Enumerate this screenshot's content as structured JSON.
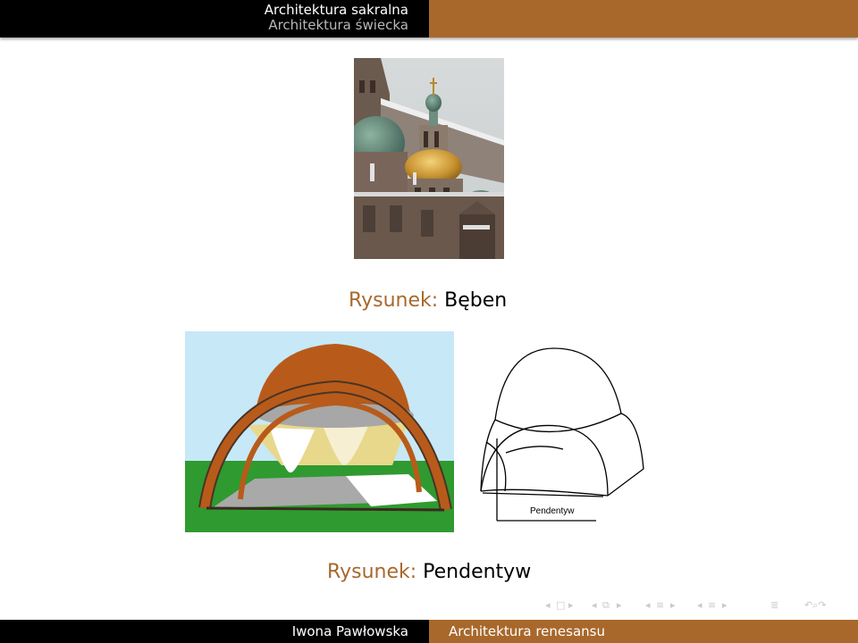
{
  "header": {
    "section_active": "Architektura sakralna",
    "section_inactive": "Architektura świecka"
  },
  "figures": [
    {
      "label": "Rysunek:",
      "caption": "Bęben"
    },
    {
      "label": "Rysunek:",
      "caption": "Pendentyw"
    }
  ],
  "diagram": {
    "pendentive_label": "Pendentyw"
  },
  "footer": {
    "author": "Iwona Pawłowska",
    "title": "Architektura renesansu"
  },
  "nav_icons": [
    "nav-frame-prev-icon",
    "nav-frame-icon",
    "nav-frame-next-icon",
    "nav-subsection-prev-icon",
    "nav-subsection-icon",
    "nav-subsection-next-icon",
    "nav-section-prev-icon",
    "nav-section-icon",
    "nav-section-next-icon",
    "nav-align-icon",
    "nav-search-icon"
  ],
  "colors": {
    "accent": "#a8682c",
    "bar": "#000000"
  }
}
